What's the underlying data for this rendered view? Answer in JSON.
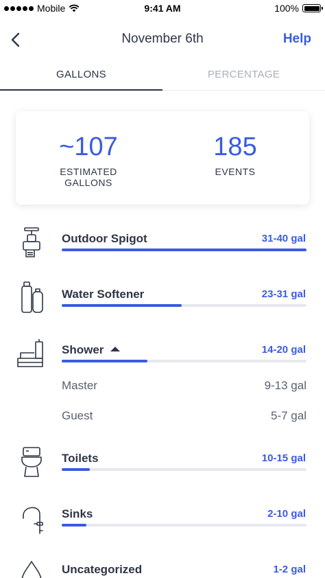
{
  "status_bar": {
    "carrier": "Mobile",
    "time": "9:41 AM",
    "battery": "100%"
  },
  "nav": {
    "title": "November 6th",
    "help_label": "Help"
  },
  "tabs": [
    {
      "label": "GALLONS",
      "active": true
    },
    {
      "label": "PERCENTAGE",
      "active": false
    }
  ],
  "summary": {
    "gallons_value": "~107",
    "gallons_label_line1": "ESTIMATED",
    "gallons_label_line2": "GALLONS",
    "events_value": "185",
    "events_label": "EVENTS"
  },
  "categories": [
    {
      "name": "Outdoor Spigot",
      "range": "31-40 gal",
      "fill": 1.0,
      "icon": "spigot-icon"
    },
    {
      "name": "Water Softener",
      "range": "23-31 gal",
      "fill": 0.49,
      "icon": "water-softener-icon"
    },
    {
      "name": "Shower",
      "range": "14-20 gal",
      "fill": 0.35,
      "icon": "shower-icon",
      "expanded": true,
      "sub": [
        {
          "name": "Master",
          "range": "9-13 gal"
        },
        {
          "name": "Guest",
          "range": "5-7 gal"
        }
      ]
    },
    {
      "name": "Toilets",
      "range": "10-15 gal",
      "fill": 0.115,
      "icon": "toilet-icon"
    },
    {
      "name": "Sinks",
      "range": "2-10 gal",
      "fill": 0.1,
      "icon": "faucet-icon"
    },
    {
      "name": "Uncategorized",
      "range": "1-2 gal",
      "fill": 0.03,
      "icon": "drop-icon"
    }
  ],
  "colors": {
    "accent": "#3a5be0",
    "track": "#e6e8ee",
    "text": "#2f3546"
  }
}
